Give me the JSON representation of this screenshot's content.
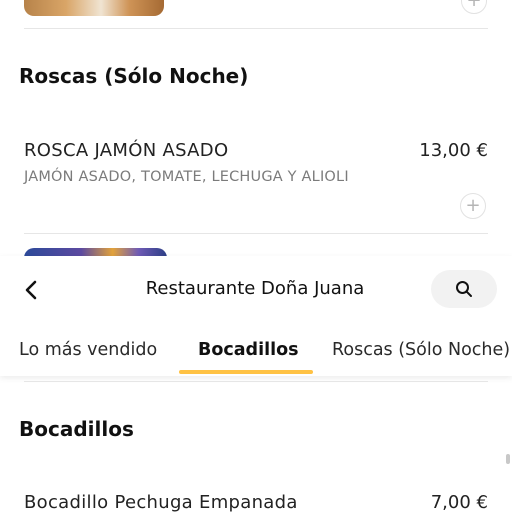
{
  "header": {
    "title": "Restaurante Doña Juana",
    "tabs": [
      {
        "label": "Lo más vendido"
      },
      {
        "label": "Bocadillos"
      },
      {
        "label": "Roscas (Sólo Noche)"
      }
    ],
    "active_tab": "Bocadillos",
    "accent_color": "#ffc244"
  },
  "sections": {
    "roscas": {
      "title": "Roscas (Sólo Noche)",
      "item": {
        "name": "ROSCA JAMÓN ASADO",
        "description": "JAMÓN ASADO, TOMATE, LECHUGA Y ALIOLI",
        "price": "13,00 €"
      }
    },
    "bocadillos": {
      "title": "Bocadillos",
      "item": {
        "name": "Bocadillo Pechuga Empanada",
        "price": "7,00 €"
      }
    }
  },
  "icons": {
    "back": "chevron-left-icon",
    "search": "search-icon",
    "add": "plus-icon"
  }
}
